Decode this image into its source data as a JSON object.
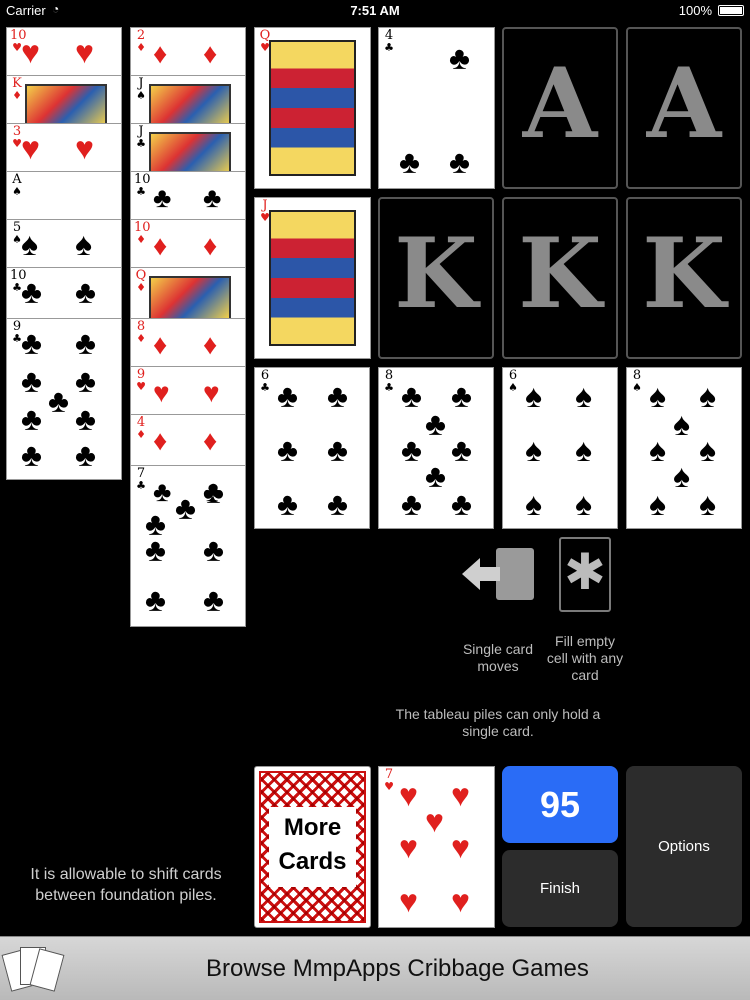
{
  "status": {
    "carrier": "Carrier",
    "time": "7:51 AM",
    "battery": "100%"
  },
  "col1": [
    {
      "r": "10",
      "s": "♥",
      "c": "red"
    },
    {
      "r": "K",
      "s": "♦",
      "c": "red"
    },
    {
      "r": "3",
      "s": "♥",
      "c": "red"
    },
    {
      "r": "A",
      "s": "♠",
      "c": "blk"
    },
    {
      "r": "5",
      "s": "♠",
      "c": "blk"
    },
    {
      "r": "10",
      "s": "♣",
      "c": "blk"
    },
    {
      "r": "9",
      "s": "♣",
      "c": "blk"
    }
  ],
  "col2": [
    {
      "r": "2",
      "s": "♦",
      "c": "red"
    },
    {
      "r": "J",
      "s": "♠",
      "c": "blk"
    },
    {
      "r": "J",
      "s": "♣",
      "c": "blk"
    },
    {
      "r": "10",
      "s": "♣",
      "c": "blk"
    },
    {
      "r": "10",
      "s": "♦",
      "c": "red"
    },
    {
      "r": "Q",
      "s": "♦",
      "c": "red"
    },
    {
      "r": "8",
      "s": "♦",
      "c": "red"
    },
    {
      "r": "9",
      "s": "♥",
      "c": "red"
    },
    {
      "r": "4",
      "s": "♦",
      "c": "red"
    },
    {
      "r": "7",
      "s": "♣",
      "c": "blk"
    }
  ],
  "top_cards": [
    {
      "r": "Q",
      "s": "♥",
      "c": "red"
    },
    {
      "r": "4",
      "s": "♣",
      "c": "blk"
    },
    {
      "r": "J",
      "s": "♥",
      "c": "red"
    }
  ],
  "foundations": {
    "ace1": "A",
    "ace2": "A",
    "king1": "K",
    "king2": "K",
    "king3": "K"
  },
  "tableau": [
    {
      "r": "6",
      "s": "♣",
      "c": "blk"
    },
    {
      "r": "8",
      "s": "♣",
      "c": "blk"
    },
    {
      "r": "6",
      "s": "♠",
      "c": "blk"
    },
    {
      "r": "8",
      "s": "♠",
      "c": "blk"
    }
  ],
  "hints": {
    "single_move": "Single card moves",
    "fill_empty": "Fill empty cell with any card",
    "tableau_rule": "The tableau piles can only hold a single card.",
    "shift_rule": "It is allowable to shift cards between foundation piles."
  },
  "deck": {
    "label_line1": "More",
    "label_line2": "Cards"
  },
  "waste": {
    "r": "7",
    "s": "♥",
    "c": "red"
  },
  "score": "95",
  "buttons": {
    "finish": "Finish",
    "options": "Options"
  },
  "banner": {
    "title": "Browse MmpApps Cribbage Games"
  },
  "colors": {
    "score_bg": "#2a6cf6",
    "btn_bg": "#2c2c2c"
  }
}
